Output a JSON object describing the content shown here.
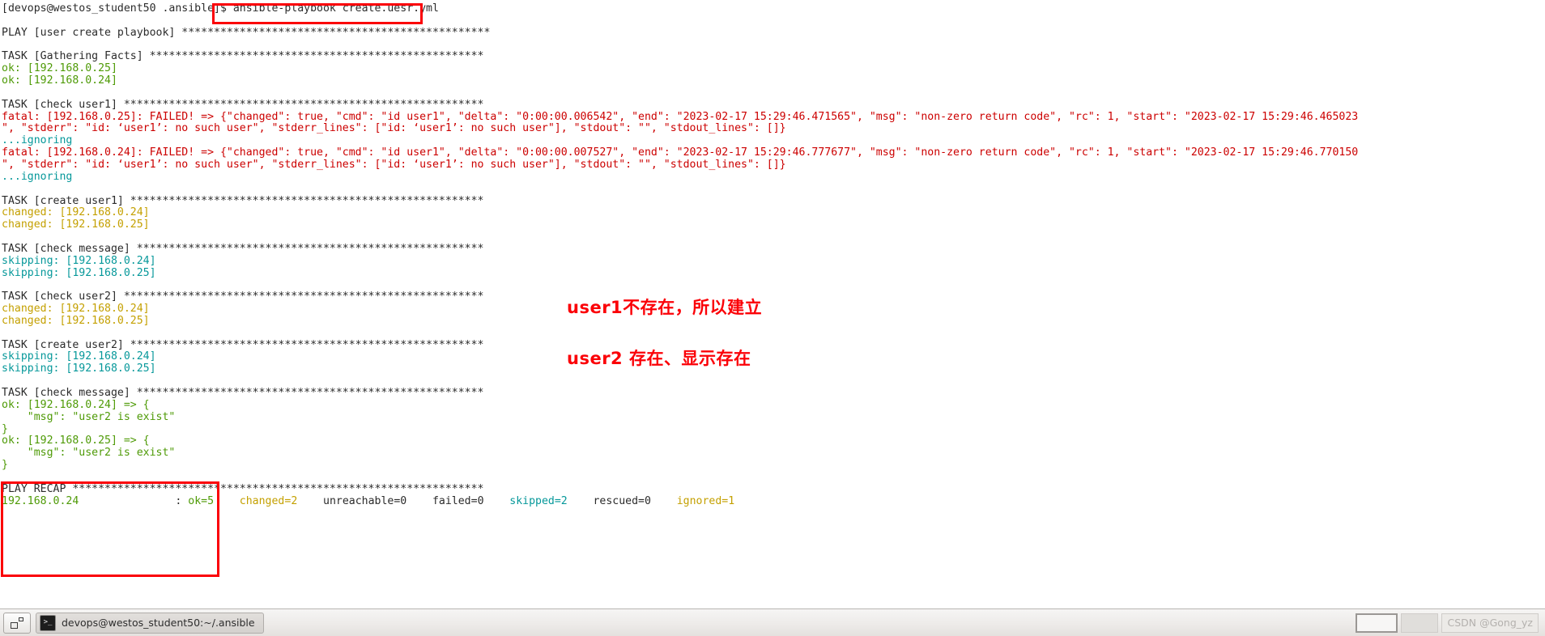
{
  "terminal": {
    "prompt": "[devops@westos_student50 .ansible]$ ",
    "command": "ansible-playbook create.uesr.yml",
    "lines": [
      {
        "text": "[devops@westos_student50 .ansible]$ ansible-playbook create.uesr.yml",
        "color": "default"
      },
      {
        "text": "",
        "color": "default"
      },
      {
        "text": "PLAY [user create playbook] ************************************************",
        "color": "default"
      },
      {
        "text": "",
        "color": "default"
      },
      {
        "text": "TASK [Gathering Facts] ****************************************************",
        "color": "default"
      },
      {
        "text": "ok: [192.168.0.25]",
        "color": "green"
      },
      {
        "text": "ok: [192.168.0.24]",
        "color": "green"
      },
      {
        "text": "",
        "color": "default"
      },
      {
        "text": "TASK [check user1] ********************************************************",
        "color": "default"
      },
      {
        "text": "fatal: [192.168.0.25]: FAILED! => {\"changed\": true, \"cmd\": \"id user1\", \"delta\": \"0:00:00.006542\", \"end\": \"2023-02-17 15:29:46.471565\", \"msg\": \"non-zero return code\", \"rc\": 1, \"start\": \"2023-02-17 15:29:46.465023",
        "color": "red"
      },
      {
        "text": "\", \"stderr\": \"id: ‘user1’: no such user\", \"stderr_lines\": [\"id: ‘user1’: no such user\"], \"stdout\": \"\", \"stdout_lines\": []}",
        "color": "red"
      },
      {
        "text": "...ignoring",
        "color": "cyan"
      },
      {
        "text": "fatal: [192.168.0.24]: FAILED! => {\"changed\": true, \"cmd\": \"id user1\", \"delta\": \"0:00:00.007527\", \"end\": \"2023-02-17 15:29:46.777677\", \"msg\": \"non-zero return code\", \"rc\": 1, \"start\": \"2023-02-17 15:29:46.770150",
        "color": "red"
      },
      {
        "text": "\", \"stderr\": \"id: ‘user1’: no such user\", \"stderr_lines\": [\"id: ‘user1’: no such user\"], \"stdout\": \"\", \"stdout_lines\": []}",
        "color": "red"
      },
      {
        "text": "...ignoring",
        "color": "cyan"
      },
      {
        "text": "",
        "color": "default"
      },
      {
        "text": "TASK [create user1] *******************************************************",
        "color": "default"
      },
      {
        "text": "changed: [192.168.0.24]",
        "color": "yellow"
      },
      {
        "text": "changed: [192.168.0.25]",
        "color": "yellow"
      },
      {
        "text": "",
        "color": "default"
      },
      {
        "text": "TASK [check message] ******************************************************",
        "color": "default"
      },
      {
        "text": "skipping: [192.168.0.24]",
        "color": "cyan"
      },
      {
        "text": "skipping: [192.168.0.25]",
        "color": "cyan"
      },
      {
        "text": "",
        "color": "default"
      },
      {
        "text": "TASK [check user2] ********************************************************",
        "color": "default"
      },
      {
        "text": "changed: [192.168.0.24]",
        "color": "yellow"
      },
      {
        "text": "changed: [192.168.0.25]",
        "color": "yellow"
      },
      {
        "text": "",
        "color": "default"
      },
      {
        "text": "TASK [create user2] *******************************************************",
        "color": "default"
      },
      {
        "text": "skipping: [192.168.0.24]",
        "color": "cyan"
      },
      {
        "text": "skipping: [192.168.0.25]",
        "color": "cyan"
      },
      {
        "text": "",
        "color": "default"
      },
      {
        "text": "TASK [check message] ******************************************************",
        "color": "default"
      },
      {
        "text": "ok: [192.168.0.24] => {",
        "color": "green"
      },
      {
        "text": "    \"msg\": \"user2 is exist\"",
        "color": "green"
      },
      {
        "text": "}",
        "color": "green"
      },
      {
        "text": "ok: [192.168.0.25] => {",
        "color": "green"
      },
      {
        "text": "    \"msg\": \"user2 is exist\"",
        "color": "green"
      },
      {
        "text": "}",
        "color": "green"
      },
      {
        "text": "",
        "color": "default"
      },
      {
        "text": "PLAY RECAP ****************************************************************",
        "color": "default"
      },
      {
        "text": "192.168.0.24               : ok=5    changed=2    unreachable=0    failed=0    skipped=2    rescued=0    ignored=1",
        "color": "recap"
      }
    ],
    "colors": {
      "default": "#2b2b2b",
      "green": "#4e9a06",
      "red": "#cc0000",
      "yellow": "#c4a000",
      "cyan": "#06989a",
      "background": "#ffffff"
    }
  },
  "annotations": {
    "highlight_color": "#fb0007",
    "note_1": "user1不存在，所以建立",
    "note_2": "user2 存在、显示存在"
  },
  "taskbar": {
    "show_desktop_label": "",
    "window_title": "devops@westos_student50:~/.ansible",
    "terminal_icon_glyph": ">_",
    "watermark": "CSDN @Gong_yz"
  }
}
